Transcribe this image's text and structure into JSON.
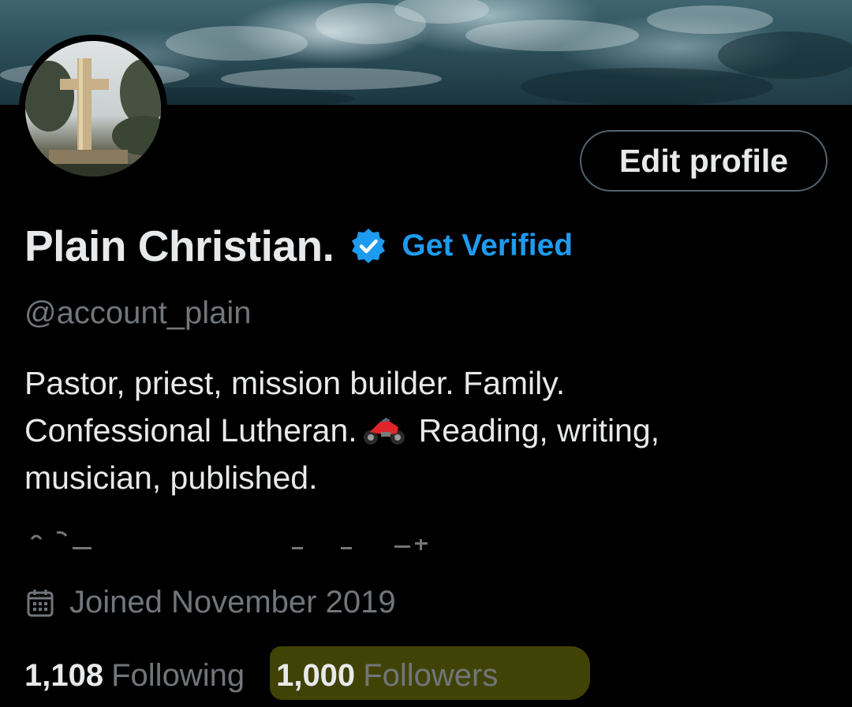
{
  "profile": {
    "display_name": "Plain Christian.",
    "get_verified_label": "Get Verified",
    "handle": "@account_plain",
    "bio_lines": [
      "Pastor, priest, mission builder. Family.",
      "Confessional Lutheran.",
      "Reading, writing,",
      "musician, published."
    ],
    "bio_emoji": "motorcycle-icon",
    "joined": "Joined November 2019",
    "following_count": "1,108",
    "following_label": "Following",
    "followers_count": "1,000",
    "followers_label": "Followers"
  },
  "actions": {
    "edit_profile_label": "Edit profile"
  },
  "icons": {
    "verified": "verified-badge-icon",
    "calendar": "calendar-icon"
  },
  "colors": {
    "background": "#000000",
    "text_primary": "#e7e9ea",
    "text_secondary": "#71767b",
    "accent": "#1d9bf0",
    "button_border": "#536471",
    "highlight": "#d6de14"
  }
}
